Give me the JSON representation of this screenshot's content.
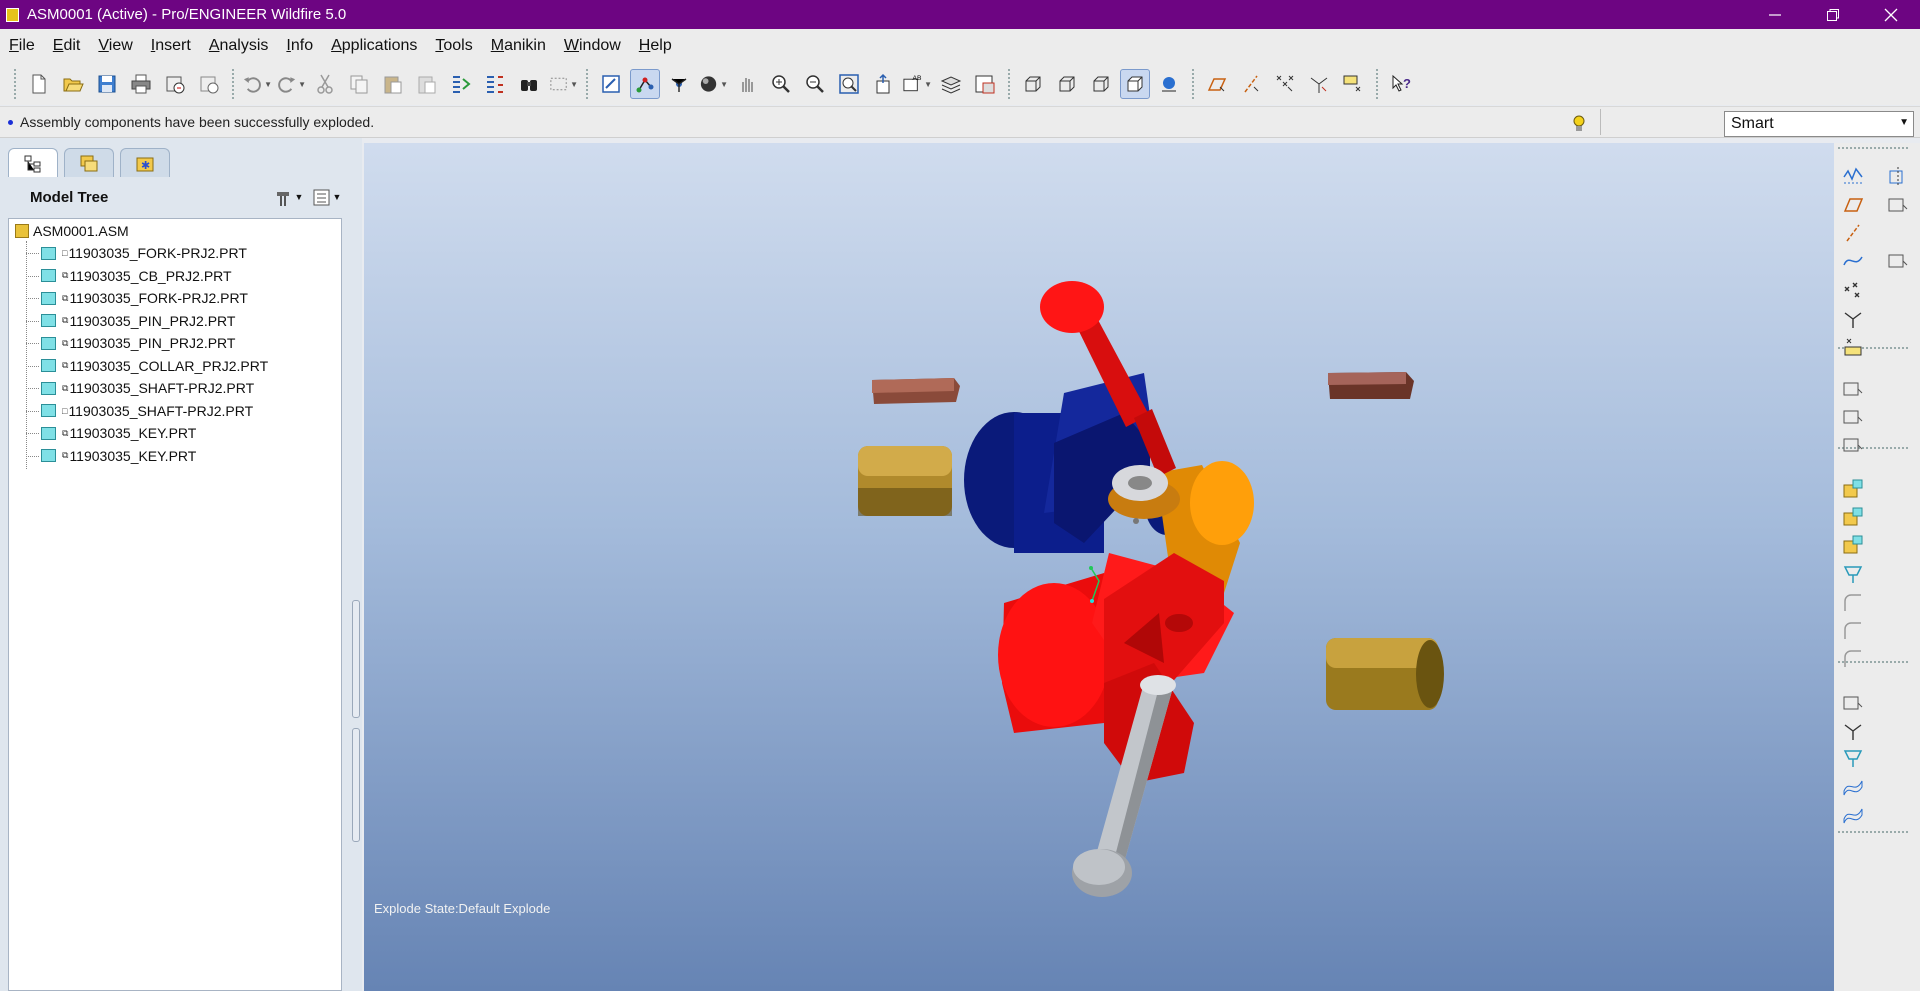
{
  "window": {
    "title": "ASM0001 (Active) - Pro/ENGINEER Wildfire 5.0",
    "controls": [
      "minimize-icon",
      "restore-icon",
      "close-icon"
    ]
  },
  "menu": [
    {
      "label": "File",
      "u": "F",
      "rest": "ile"
    },
    {
      "label": "Edit",
      "u": "E",
      "rest": "dit"
    },
    {
      "label": "View",
      "u": "V",
      "rest": "iew"
    },
    {
      "label": "Insert",
      "u": "I",
      "rest": "nsert"
    },
    {
      "label": "Analysis",
      "u": "A",
      "rest": "nalysis"
    },
    {
      "label": "Info",
      "u": "I",
      "rest": "nfo"
    },
    {
      "label": "Applications",
      "u": "A",
      "rest": "pplications"
    },
    {
      "label": "Tools",
      "u": "T",
      "rest": "ools"
    },
    {
      "label": "Manikin",
      "u": "M",
      "rest": "anikin"
    },
    {
      "label": "Window",
      "u": "W",
      "rest": "indow"
    },
    {
      "label": "Help",
      "u": "H",
      "rest": "elp"
    }
  ],
  "toolbar_icons": [
    "new-icon",
    "open-icon",
    "save-icon",
    "print-icon",
    "email-icon",
    "email-link-icon",
    "undo-icon",
    "redo-icon",
    "cut-icon",
    "copy-icon",
    "paste-icon",
    "paste-special-icon",
    "regenerate-icon",
    "regen-manager-icon",
    "find-icon",
    "select-box-icon",
    "repaint-icon",
    "orient-mode-icon",
    "spin-center-icon",
    "shade-icon",
    "pan-icon",
    "zoom-in-icon",
    "zoom-out-icon",
    "refit-icon",
    "reorient-icon",
    "saved-views-icon",
    "layers-icon",
    "view-manager-icon",
    "wireframe-icon",
    "hidden-line-icon",
    "no-hidden-icon",
    "shading-icon",
    "enhanced-realism-icon",
    "datum-planes-icon",
    "datum-axes-icon",
    "datum-points-icon",
    "coord-sys-icon",
    "annotations-icon",
    "whats-this-icon"
  ],
  "message": {
    "text": "Assembly components have been successfully exploded.",
    "filter": "Smart"
  },
  "navigator": {
    "tabs": [
      "model-tree-tab-icon",
      "folder-browser-tab-icon",
      "favorites-tab-icon"
    ],
    "header": "Model Tree",
    "root": "ASM0001.ASM",
    "items": [
      {
        "name": "11903035_FORK-PRJ2.PRT",
        "mark": "□"
      },
      {
        "name": "11903035_CB_PRJ2.PRT",
        "mark": "⧉"
      },
      {
        "name": "11903035_FORK-PRJ2.PRT",
        "mark": "⧉"
      },
      {
        "name": "11903035_PIN_PRJ2.PRT",
        "mark": "⧉"
      },
      {
        "name": "11903035_PIN_PRJ2.PRT",
        "mark": "⧉"
      },
      {
        "name": "11903035_COLLAR_PRJ2.PRT",
        "mark": "⧉"
      },
      {
        "name": "11903035_SHAFT-PRJ2.PRT",
        "mark": "⧉"
      },
      {
        "name": "11903035_SHAFT-PRJ2.PRT",
        "mark": "□"
      },
      {
        "name": "11903035_KEY.PRT",
        "mark": "⧉"
      },
      {
        "name": "11903035_KEY.PRT",
        "mark": "⧉"
      }
    ]
  },
  "graphics": {
    "explode_state": "Explode State:Default Explode",
    "colors": {
      "red": "#ff1010",
      "navy": "#0a1a8a",
      "gold": "#b8902a",
      "orange": "#ff9f0a",
      "gray": "#c8cdd2",
      "brown": "#8a4a3a"
    }
  },
  "right_toolbar_icons": [
    "sketch-tool-icon",
    "datum-plane-tool-icon",
    "datum-axis-tool-icon",
    "datum-curve-tool-icon",
    "datum-point-tool-icon",
    "csys-tool-icon",
    "analysis-tool-icon",
    "insert-component-icon",
    "create-component-icon",
    "repeat-component-icon",
    "assemble-icon",
    "create-new-icon",
    "package-icon",
    "cut-tool-icon",
    "round-icon",
    "chamfer-icon",
    "draft-icon",
    "copy-geometry-icon",
    "merge-icon",
    "flexible-icon",
    "annotation-icon",
    "mirror-icon",
    "shell-icon",
    "surface-icon",
    "pattern-icon"
  ]
}
